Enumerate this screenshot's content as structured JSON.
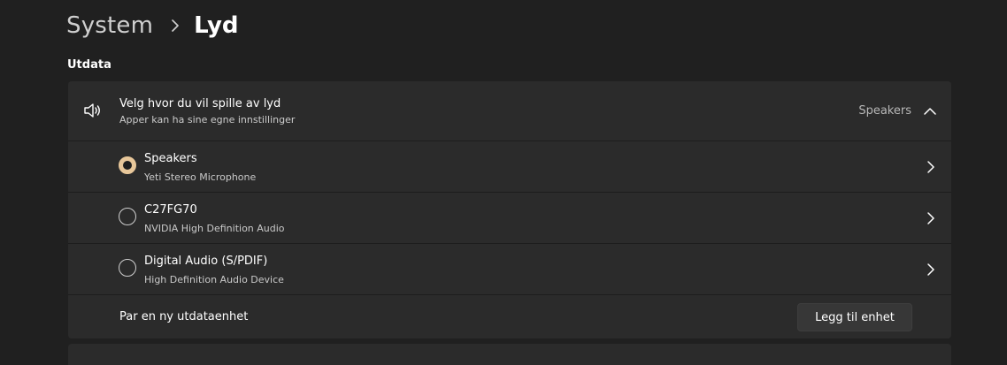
{
  "breadcrumb": {
    "parent": "System",
    "current": "Lyd"
  },
  "output": {
    "section_title": "Utdata",
    "choose": {
      "title": "Velg hvor du vil spille av lyd",
      "subtitle": "Apper kan ha sine egne innstillinger",
      "selected_value": "Speakers",
      "expanded": true
    },
    "devices": [
      {
        "name": "Speakers",
        "subtitle": "Yeti Stereo Microphone",
        "selected": true
      },
      {
        "name": "C27FG70",
        "subtitle": "NVIDIA High Definition Audio",
        "selected": false
      },
      {
        "name": "Digital Audio (S/PDIF)",
        "subtitle": "High Definition Audio Device",
        "selected": false
      }
    ],
    "pair": {
      "label": "Par en ny utdataenhet",
      "button_label": "Legg til enhet"
    }
  },
  "colors": {
    "background": "#202020",
    "card": "#2b2b2b",
    "accent": "#e8c79a"
  },
  "icons": {
    "speaker": "speaker-icon",
    "chevron_up": "chevron-up-icon",
    "chevron_right": "chevron-right-icon"
  }
}
